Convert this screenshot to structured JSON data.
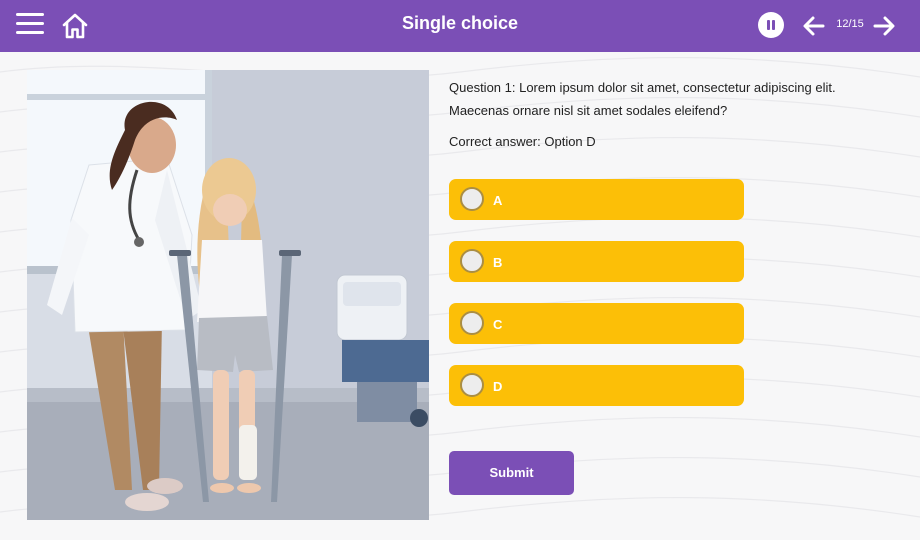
{
  "header": {
    "title": "Single choice",
    "page_counter": "12/15",
    "icons": {
      "menu": "hamburger-menu-icon",
      "home": "home-icon",
      "pause": "pause-icon",
      "prev": "arrow-left-icon",
      "next": "arrow-right-icon"
    },
    "color": "#7b4fb6"
  },
  "question": {
    "text": "Question 1: Lorem ipsum dolor sit amet, consectetur adipiscing elit. Maecenas ornare nisl sit amet sodales eleifend?",
    "correct_answer": "Correct answer: Option D"
  },
  "options": [
    {
      "label": "A",
      "selected": false
    },
    {
      "label": "B",
      "selected": false
    },
    {
      "label": "C",
      "selected": false
    },
    {
      "label": "D",
      "selected": false
    }
  ],
  "submit_label": "Submit",
  "colors": {
    "option": "#fcbf07",
    "accent": "#7b4fb6",
    "background": "#f7f7f8"
  }
}
